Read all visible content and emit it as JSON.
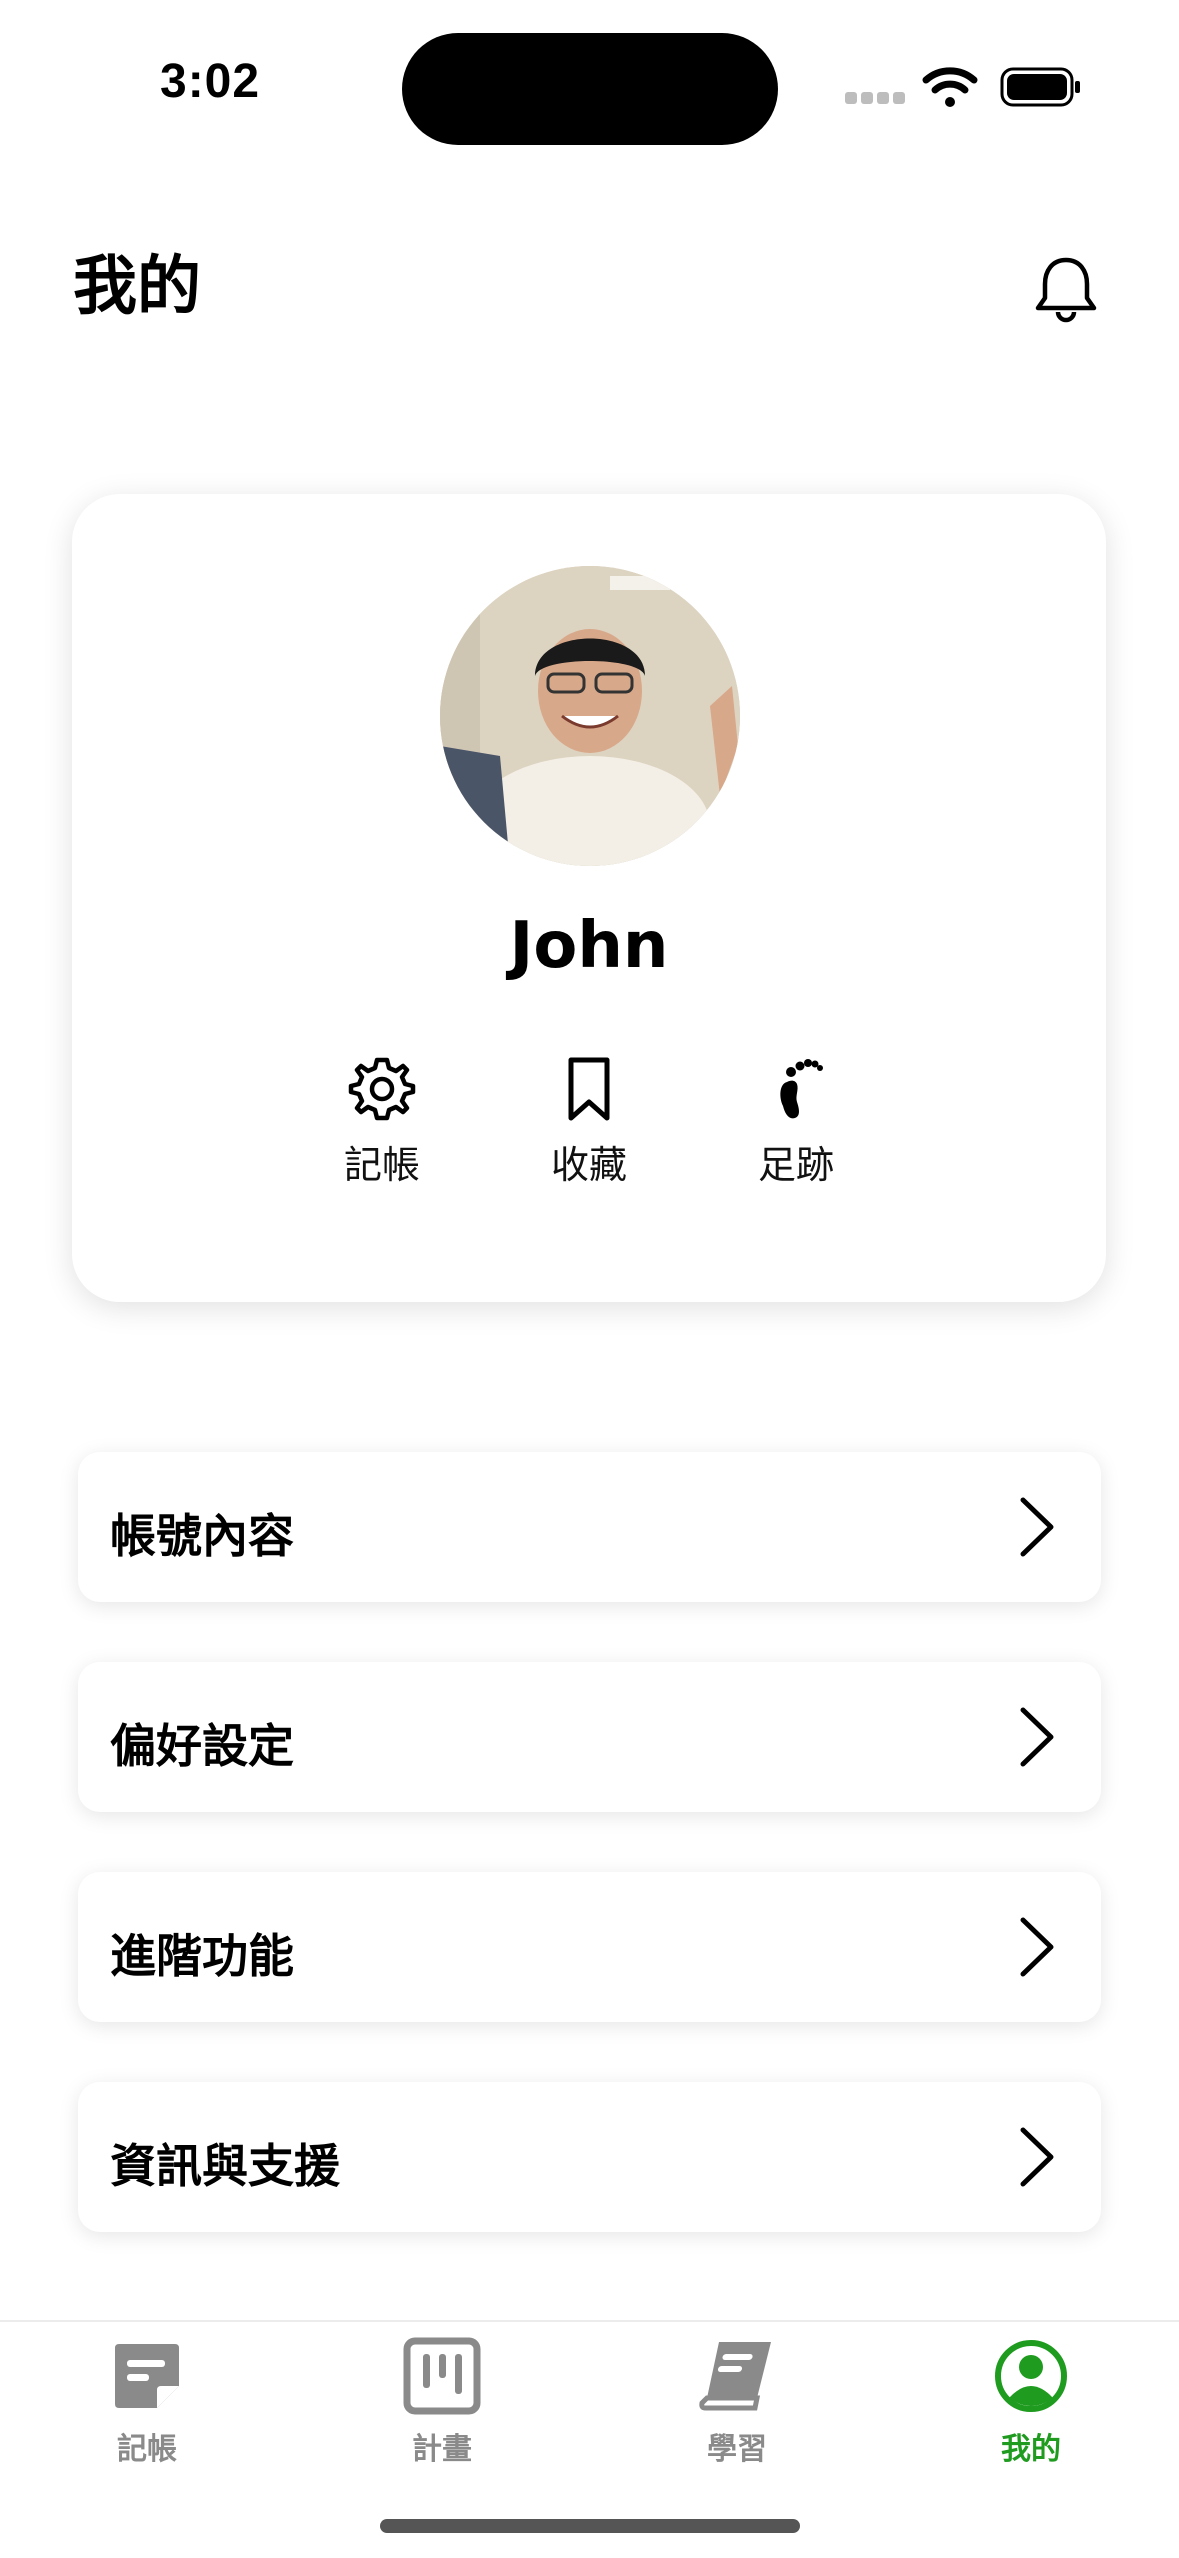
{
  "status_bar": {
    "time": "3:02"
  },
  "header": {
    "title": "我的"
  },
  "profile": {
    "name": "John",
    "quick_actions": [
      {
        "label": "記帳",
        "icon": "gear-icon"
      },
      {
        "label": "收藏",
        "icon": "bookmark-icon"
      },
      {
        "label": "足跡",
        "icon": "footprint-icon"
      }
    ]
  },
  "menu": [
    {
      "label": "帳號內容"
    },
    {
      "label": "偏好設定"
    },
    {
      "label": "進階功能"
    },
    {
      "label": "資訊與支援"
    }
  ],
  "tabbar": {
    "items": [
      {
        "label": "記帳",
        "icon": "note-icon"
      },
      {
        "label": "計畫",
        "icon": "plan-board-icon"
      },
      {
        "label": "學習",
        "icon": "book-icon"
      },
      {
        "label": "我的",
        "icon": "profile-icon"
      }
    ],
    "active_index": 3,
    "active_color": "#1f9b1f",
    "inactive_color": "#8a8a8a"
  }
}
